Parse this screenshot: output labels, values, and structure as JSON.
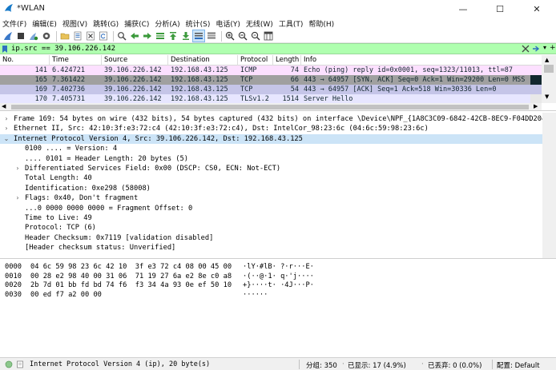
{
  "window": {
    "title": "*WLAN",
    "minimize": "—",
    "maximize": "☐",
    "close": "✕"
  },
  "menu": [
    "文件(F)",
    "编辑(E)",
    "视图(V)",
    "跳转(G)",
    "捕获(C)",
    "分析(A)",
    "统计(S)",
    "电话(Y)",
    "无线(W)",
    "工具(T)",
    "帮助(H)"
  ],
  "filter": {
    "value": "ip.src == 39.106.226.142",
    "dropdown": "▾",
    "add": "+"
  },
  "packet_list": {
    "columns": [
      "No.",
      "Time",
      "Source",
      "Destination",
      "Protocol",
      "Length",
      "Info"
    ],
    "rows": [
      {
        "no": "141",
        "time": "6.424721",
        "src": "39.106.226.142",
        "dst": "192.168.43.125",
        "proto": "ICMP",
        "len": "74",
        "info": "Echo (ping) reply    id=0x0001, seq=1323/11013, ttl=87",
        "bg": "#fce0ff",
        "fg": "#12272e"
      },
      {
        "no": "165",
        "time": "7.361422",
        "src": "39.106.226.142",
        "dst": "192.168.43.125",
        "proto": "TCP",
        "len": "66",
        "info": "443 → 64957 [SYN, ACK] Seq=0 Ack=1 Win=29200 Len=0 MSS",
        "bg": "#a0a0a0",
        "fg": "#12272e"
      },
      {
        "no": "169",
        "time": "7.402736",
        "src": "39.106.226.142",
        "dst": "192.168.43.125",
        "proto": "TCP",
        "len": "54",
        "info": "443 → 64957 [ACK] Seq=1 Ack=518 Win=30336 Len=0",
        "bg": "#c5c5e8",
        "fg": "#12272e"
      },
      {
        "no": "170",
        "time": "7.405731",
        "src": "39.106.226.142",
        "dst": "192.168.43.125",
        "proto": "TLSv1.2",
        "len": "1514",
        "info": "Server Hello",
        "bg": "#e7e6ff",
        "fg": "#12272e"
      }
    ]
  },
  "details": [
    {
      "indent": 0,
      "arrow": "›",
      "text": "Frame 169: 54 bytes on wire (432 bits), 54 bytes captured (432 bits) on interface \\Device\\NPF_{1A8C3C09-6842-42CB-8EC9-F04DD2049"
    },
    {
      "indent": 0,
      "arrow": "›",
      "text": "Ethernet II, Src: 42:10:3f:e3:72:c4 (42:10:3f:e3:72:c4), Dst: IntelCor_98:23:6c (04:6c:59:98:23:6c)"
    },
    {
      "indent": 0,
      "arrow": "⌄",
      "text": "Internet Protocol Version 4, Src: 39.106.226.142, Dst: 192.168.43.125"
    },
    {
      "indent": 1,
      "arrow": "",
      "text": "0100 .... = Version: 4"
    },
    {
      "indent": 1,
      "arrow": "",
      "text": ".... 0101 = Header Length: 20 bytes (5)"
    },
    {
      "indent": 1,
      "arrow": "›",
      "text": "Differentiated Services Field: 0x00 (DSCP: CS0, ECN: Not-ECT)"
    },
    {
      "indent": 1,
      "arrow": "",
      "text": "Total Length: 40"
    },
    {
      "indent": 1,
      "arrow": "",
      "text": "Identification: 0xe298 (58008)"
    },
    {
      "indent": 1,
      "arrow": "›",
      "text": "Flags: 0x40, Don't fragment"
    },
    {
      "indent": 1,
      "arrow": "",
      "text": "...0 0000 0000 0000 = Fragment Offset: 0"
    },
    {
      "indent": 1,
      "arrow": "",
      "text": "Time to Live: 49"
    },
    {
      "indent": 1,
      "arrow": "",
      "text": "Protocol: TCP (6)"
    },
    {
      "indent": 1,
      "arrow": "",
      "text": "Header Checksum: 0x7119 [validation disabled]"
    },
    {
      "indent": 1,
      "arrow": "",
      "text": "[Header checksum status: Unverified]"
    }
  ],
  "bytes": [
    {
      "offset": "0000",
      "hex": "04 6c 59 98 23 6c 42 10  3f e3 72 c4 08 00 45 00",
      "ascii": "·lY·#lB· ?·r···E·"
    },
    {
      "offset": "0010",
      "hex": "00 28 e2 98 40 00 31 06  71 19 27 6a e2 8e c0 a8",
      "ascii": "·(··@·1· q·'j····"
    },
    {
      "offset": "0020",
      "hex": "2b 7d 01 bb fd bd 74 f6  f3 34 4a 93 0e ef 50 10",
      "ascii": "+}····t· ·4J···P·"
    },
    {
      "offset": "0030",
      "hex": "00 ed f7 a2 00 00",
      "ascii": "······"
    }
  ],
  "status": {
    "field": "Internet Protocol Version 4 (ip), 20 byte(s)",
    "packets": "分组: 350",
    "displayed": "已显示: 17 (4.9%)",
    "dropped": "已丢弃: 0 (0.0%)",
    "profile": "配置: Default"
  },
  "colors": {
    "filter_ok": "#afffaf",
    "selected_row": "#cce4f7"
  }
}
